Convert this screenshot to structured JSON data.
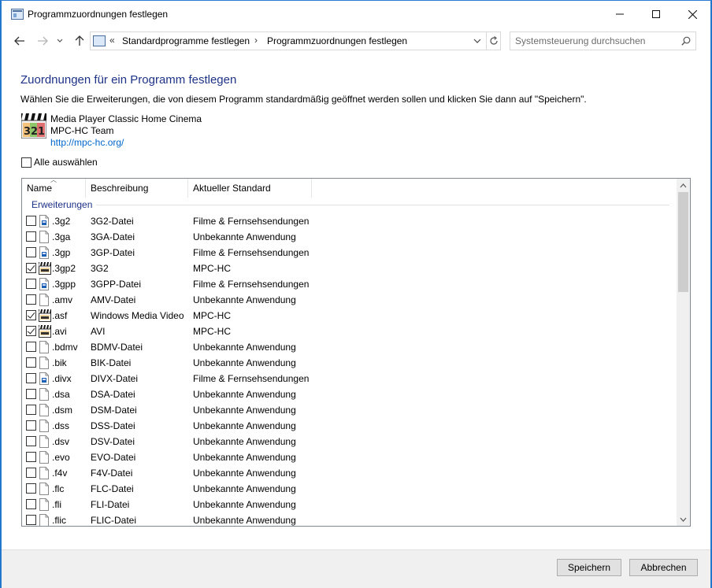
{
  "window": {
    "title": "Programmzuordnungen festlegen"
  },
  "address": {
    "breadcrumb_prefix": "«",
    "crumbs": [
      "Standardprogramme festlegen",
      "Programmzuordnungen festlegen"
    ],
    "separator": "›"
  },
  "search": {
    "placeholder": "Systemsteuerung durchsuchen"
  },
  "content": {
    "heading": "Zuordnungen für ein Programm festlegen",
    "description": "Wählen Sie die Erweiterungen, die von diesem Programm standardmäßig geöffnet werden sollen und klicken Sie dann auf \"Speichern\".",
    "app_name": "Media Player Classic Home Cinema",
    "publisher": "MPC-HC Team",
    "link": "http://mpc-hc.org/",
    "select_all": "Alle auswählen"
  },
  "list": {
    "columns": [
      "Name",
      "Beschreibung",
      "Aktueller Standard"
    ],
    "group": "Erweiterungen",
    "rows": [
      {
        "name": ".3g2",
        "desc": "3G2-Datei",
        "std": "Filme & Fernsehsendungen",
        "checked": false,
        "icon": "movies-file-icon"
      },
      {
        "name": ".3ga",
        "desc": "3GA-Datei",
        "std": "Unbekannte Anwendung",
        "checked": false,
        "icon": "blank-file-icon"
      },
      {
        "name": ".3gp",
        "desc": "3GP-Datei",
        "std": "Filme & Fernsehsendungen",
        "checked": false,
        "icon": "movies-file-icon"
      },
      {
        "name": ".3gp2",
        "desc": "3G2",
        "std": "MPC-HC",
        "checked": true,
        "icon": "mpc-file-icon"
      },
      {
        "name": ".3gpp",
        "desc": "3GPP-Datei",
        "std": "Filme & Fernsehsendungen",
        "checked": false,
        "icon": "movies-file-icon"
      },
      {
        "name": ".amv",
        "desc": "AMV-Datei",
        "std": "Unbekannte Anwendung",
        "checked": false,
        "icon": "blank-file-icon"
      },
      {
        "name": ".asf",
        "desc": "Windows Media Video",
        "std": "MPC-HC",
        "checked": true,
        "icon": "mpc-file-icon"
      },
      {
        "name": ".avi",
        "desc": "AVI",
        "std": "MPC-HC",
        "checked": true,
        "icon": "mpc-file-icon"
      },
      {
        "name": ".bdmv",
        "desc": "BDMV-Datei",
        "std": "Unbekannte Anwendung",
        "checked": false,
        "icon": "blank-file-icon"
      },
      {
        "name": ".bik",
        "desc": "BIK-Datei",
        "std": "Unbekannte Anwendung",
        "checked": false,
        "icon": "blank-file-icon"
      },
      {
        "name": ".divx",
        "desc": "DIVX-Datei",
        "std": "Filme & Fernsehsendungen",
        "checked": false,
        "icon": "movies-file-icon"
      },
      {
        "name": ".dsa",
        "desc": "DSA-Datei",
        "std": "Unbekannte Anwendung",
        "checked": false,
        "icon": "blank-file-icon"
      },
      {
        "name": ".dsm",
        "desc": "DSM-Datei",
        "std": "Unbekannte Anwendung",
        "checked": false,
        "icon": "blank-file-icon"
      },
      {
        "name": ".dss",
        "desc": "DSS-Datei",
        "std": "Unbekannte Anwendung",
        "checked": false,
        "icon": "blank-file-icon"
      },
      {
        "name": ".dsv",
        "desc": "DSV-Datei",
        "std": "Unbekannte Anwendung",
        "checked": false,
        "icon": "blank-file-icon"
      },
      {
        "name": ".evo",
        "desc": "EVO-Datei",
        "std": "Unbekannte Anwendung",
        "checked": false,
        "icon": "blank-file-icon"
      },
      {
        "name": ".f4v",
        "desc": "F4V-Datei",
        "std": "Unbekannte Anwendung",
        "checked": false,
        "icon": "blank-file-icon"
      },
      {
        "name": ".flc",
        "desc": "FLC-Datei",
        "std": "Unbekannte Anwendung",
        "checked": false,
        "icon": "blank-file-icon"
      },
      {
        "name": ".fli",
        "desc": "FLI-Datei",
        "std": "Unbekannte Anwendung",
        "checked": false,
        "icon": "blank-file-icon"
      },
      {
        "name": ".flic",
        "desc": "FLIC-Datei",
        "std": "Unbekannte Anwendung",
        "checked": false,
        "icon": "blank-file-icon"
      }
    ]
  },
  "buttons": {
    "save": "Speichern",
    "cancel": "Abbrechen"
  },
  "colors": {
    "heading": "#1e3287",
    "link": "#0066cc",
    "accent": "#1e76c8"
  }
}
